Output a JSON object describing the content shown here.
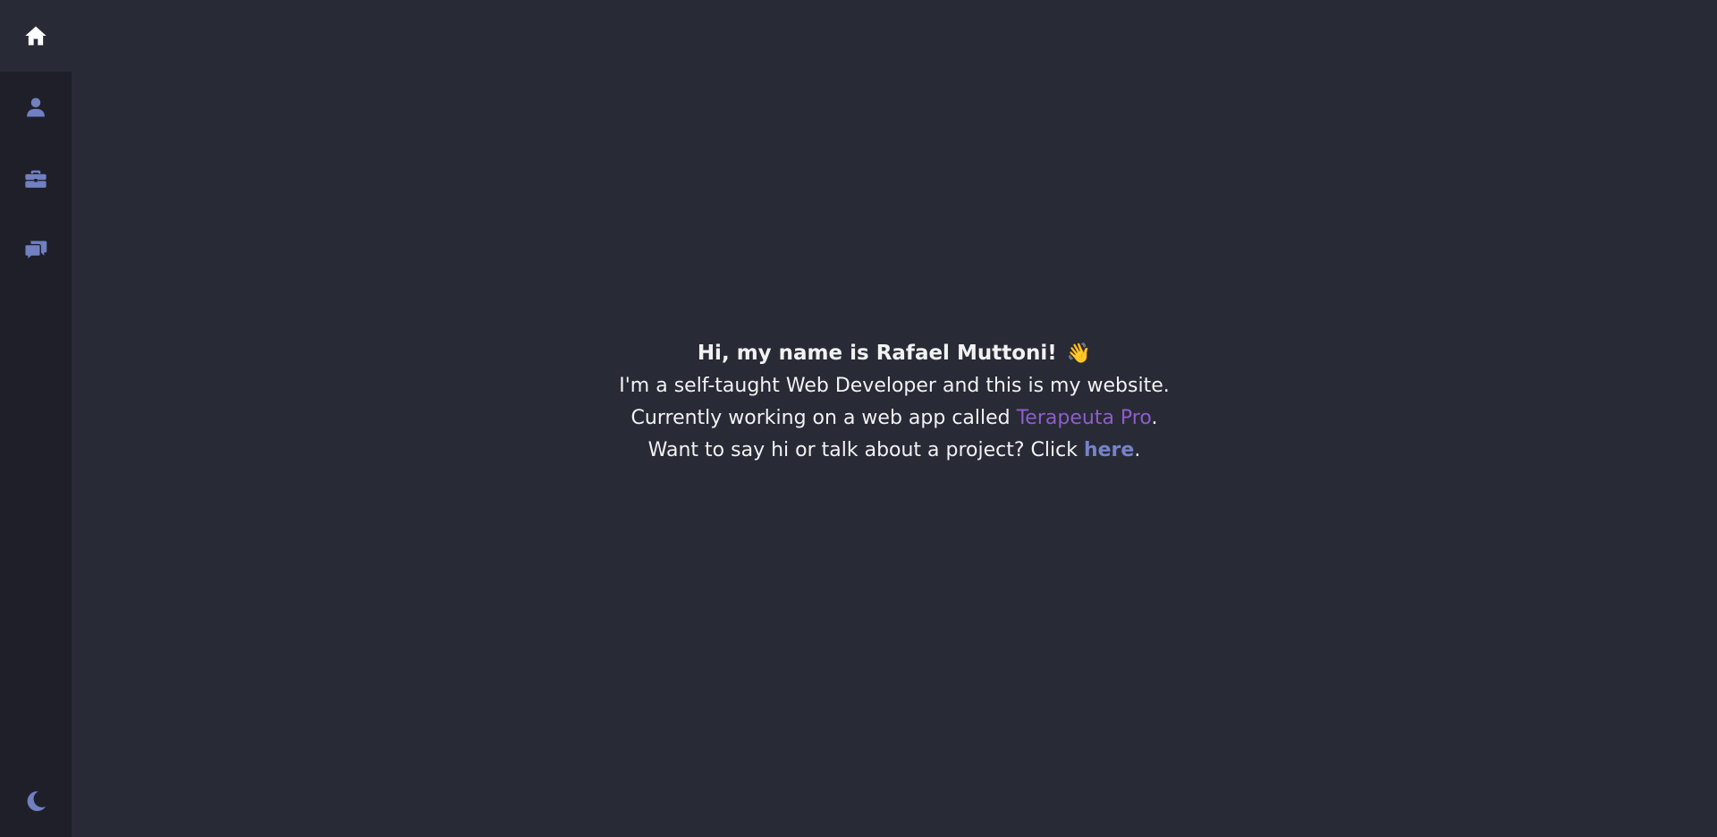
{
  "theme": {
    "background": "#282a36",
    "sidebar_background": "#1f1f2a",
    "active_icon_color": "#ffffff",
    "icon_color": "#7080c0",
    "text_color": "#f2f2f2",
    "app_link_color": "#8e5ec9",
    "contact_link_color": "#7583c9"
  },
  "sidebar": {
    "items": [
      {
        "icon": "home-icon",
        "active": true
      },
      {
        "icon": "user-icon",
        "active": false
      },
      {
        "icon": "briefcase-icon",
        "active": false
      },
      {
        "icon": "chat-icon",
        "active": false
      }
    ],
    "theme_toggle_icon": "moon-icon"
  },
  "intro": {
    "headline": "Hi, my name is Rafael Muttoni!",
    "emoji": "👋",
    "line1": "I'm a self-taught Web Developer and this is my website.",
    "line2_prefix": "Currently working on a web app called ",
    "line2_link": "Terapeuta Pro",
    "line2_suffix": ".",
    "line3_prefix": "Want to say hi or talk about a project? Click ",
    "line3_link": "here",
    "line3_suffix": "."
  }
}
